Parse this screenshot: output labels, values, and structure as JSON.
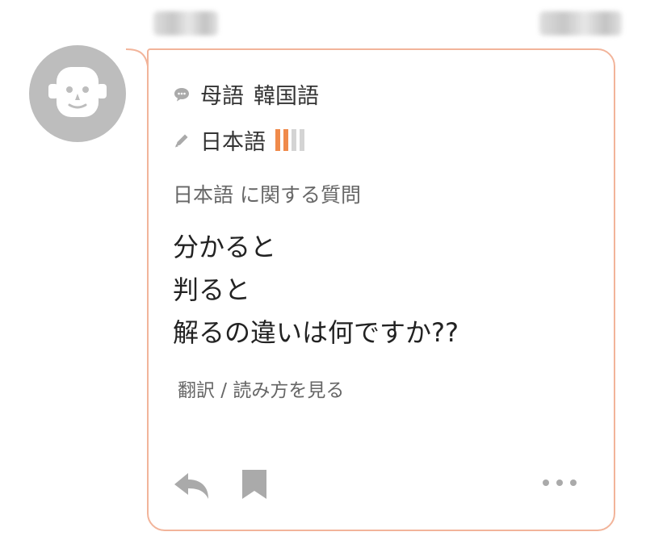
{
  "post": {
    "native_label": "母語",
    "native_language": "韓国語",
    "learning_language": "日本語",
    "proficiency_level": 2,
    "proficiency_max": 4,
    "category": "日本語 に関する質問",
    "question_lines": [
      "分かると",
      "判ると",
      "解るの違いは何ですか??"
    ],
    "translate_link": "翻訳 / 読み方を見る"
  },
  "icons": {
    "native": "speech-bubble-icon",
    "learning": "pencil-icon",
    "reply": "reply-icon",
    "bookmark": "bookmark-icon",
    "more": "more-dots-icon"
  },
  "colors": {
    "accent": "#f08a4b",
    "border": "#f2b49a",
    "icon_gray": "#aaaaaa",
    "avatar_bg": "#bdbdbd"
  }
}
